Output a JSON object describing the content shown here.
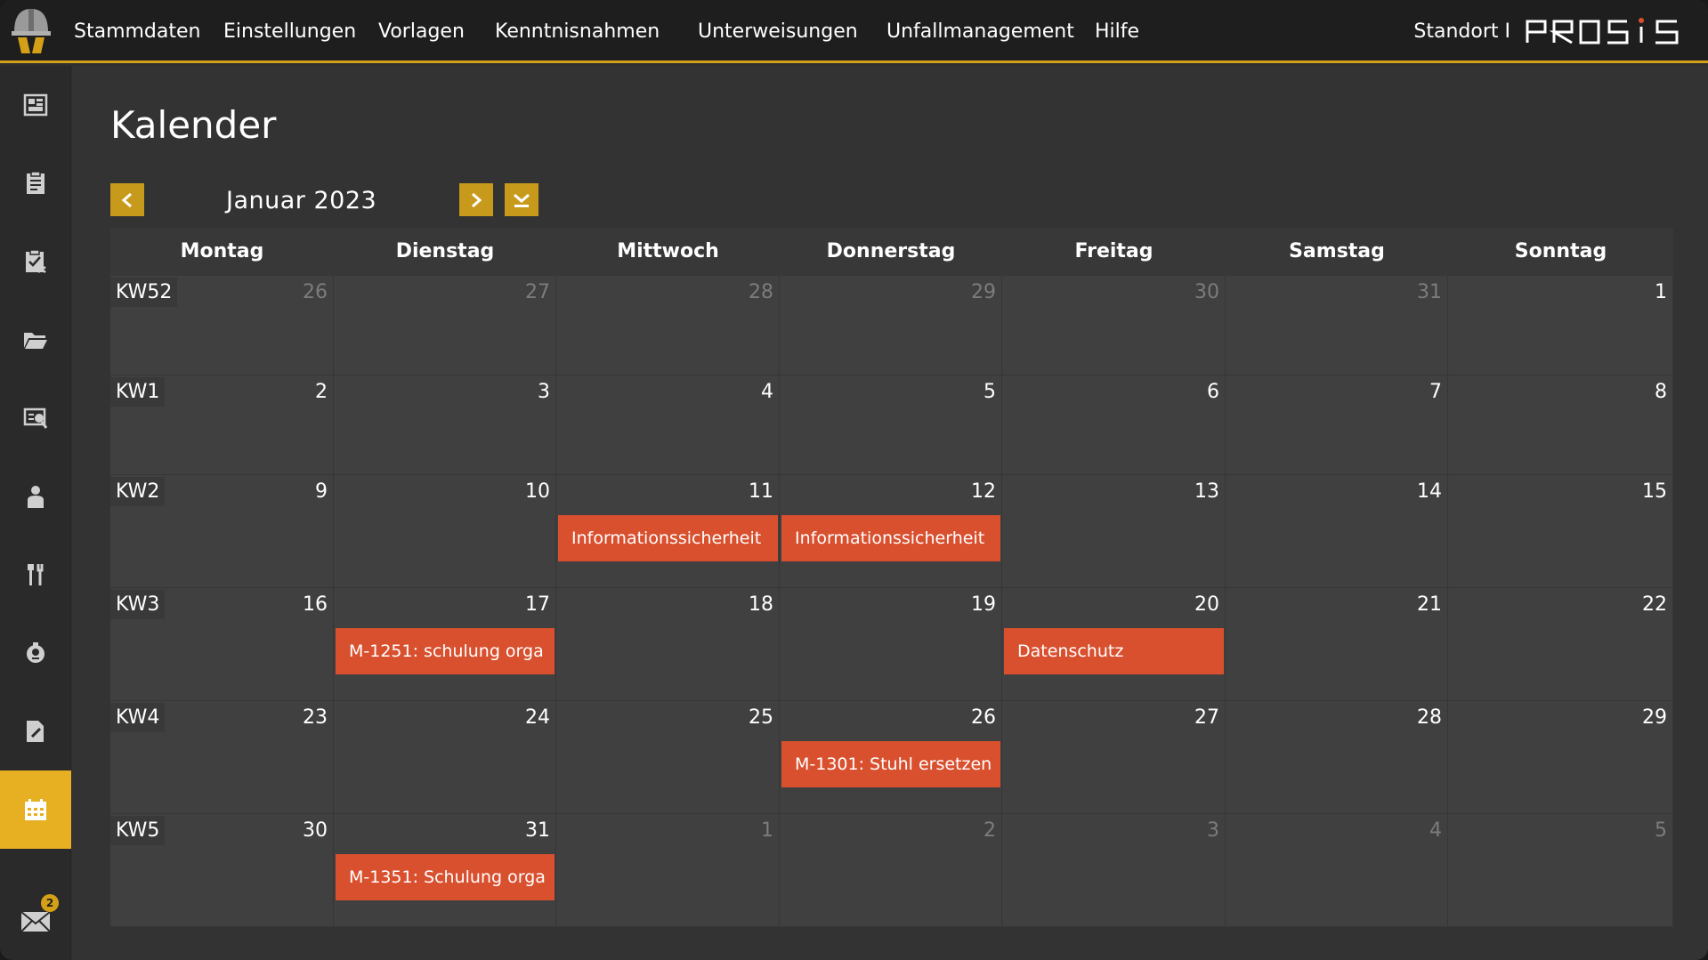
{
  "nav": {
    "items": [
      "Stammdaten",
      "Einstellungen",
      "Vorlagen",
      "Kenntnisnahmen",
      "Unterweisungen",
      "Unfallmanagement",
      "Hilfe"
    ],
    "location": "Standort I",
    "brand": "PROSIS"
  },
  "sidebar": {
    "icons": [
      "dashboard-icon",
      "clipboard-icon",
      "checklist-icon",
      "folder-icon",
      "review-icon",
      "person-icon",
      "tools-icon",
      "hazard-icon",
      "document-edit-icon",
      "calendar-icon"
    ],
    "active": "calendar-icon",
    "mail_badge": "2"
  },
  "page": {
    "title": "Kalender",
    "month_label": "Januar 2023"
  },
  "calendar": {
    "day_names": [
      "Montag",
      "Dienstag",
      "Mittwoch",
      "Donnerstag",
      "Freitag",
      "Samstag",
      "Sonntag"
    ],
    "weeks": [
      {
        "kw": "KW52",
        "days": [
          "26",
          "27",
          "28",
          "29",
          "30",
          "31",
          "1"
        ],
        "muted": [
          true,
          true,
          true,
          true,
          true,
          true,
          false
        ]
      },
      {
        "kw": "KW1",
        "days": [
          "2",
          "3",
          "4",
          "5",
          "6",
          "7",
          "8"
        ],
        "muted": [
          false,
          false,
          false,
          false,
          false,
          false,
          false
        ]
      },
      {
        "kw": "KW2",
        "days": [
          "9",
          "10",
          "11",
          "12",
          "13",
          "14",
          "15"
        ],
        "muted": [
          false,
          false,
          false,
          false,
          false,
          false,
          false
        ]
      },
      {
        "kw": "KW3",
        "days": [
          "16",
          "17",
          "18",
          "19",
          "20",
          "21",
          "22"
        ],
        "muted": [
          false,
          false,
          false,
          false,
          false,
          false,
          false
        ]
      },
      {
        "kw": "KW4",
        "days": [
          "23",
          "24",
          "25",
          "26",
          "27",
          "28",
          "29"
        ],
        "muted": [
          false,
          false,
          false,
          false,
          false,
          false,
          false
        ]
      },
      {
        "kw": "KW5",
        "days": [
          "30",
          "31",
          "1",
          "2",
          "3",
          "4",
          "5"
        ],
        "muted": [
          false,
          false,
          true,
          true,
          true,
          true,
          true
        ]
      }
    ],
    "events": [
      {
        "week": 2,
        "day": 2,
        "label": "Informationssicherheit"
      },
      {
        "week": 2,
        "day": 3,
        "label": "Informationssicherheit"
      },
      {
        "week": 3,
        "day": 1,
        "label": "M-1251: schulung orga"
      },
      {
        "week": 3,
        "day": 4,
        "label": "Datenschutz"
      },
      {
        "week": 4,
        "day": 3,
        "label": "M-1301: Stuhl ersetzen"
      },
      {
        "week": 5,
        "day": 1,
        "label": "M-1351: Schulung orga"
      }
    ]
  },
  "colors": {
    "accent": "#e6b022",
    "event": "#d9502f",
    "topbar": "#1e1e1e"
  }
}
